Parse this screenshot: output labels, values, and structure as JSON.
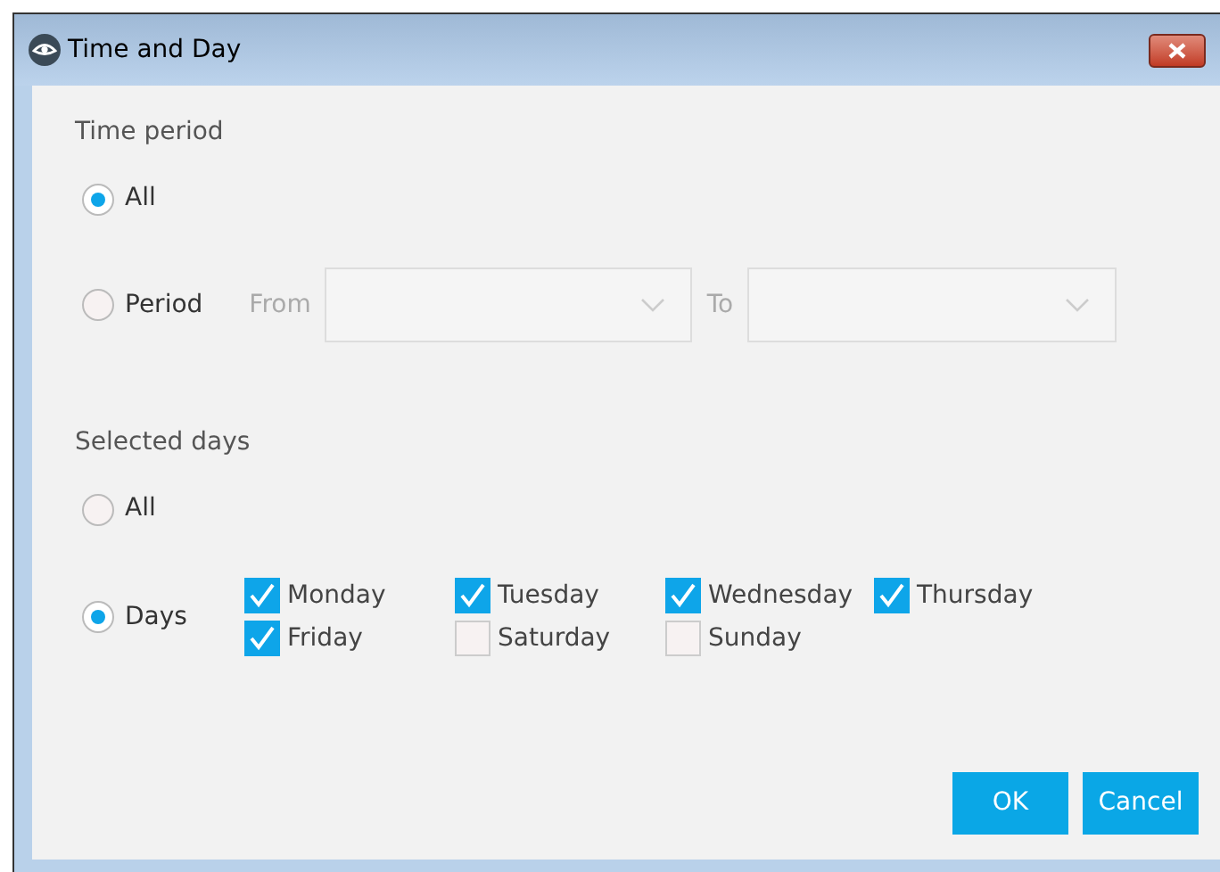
{
  "window": {
    "title": "Time and Day"
  },
  "time_period": {
    "label": "Time period",
    "options": [
      {
        "label": "All",
        "selected": true
      },
      {
        "label": "Period",
        "selected": false
      }
    ],
    "from": {
      "label": "From",
      "disabled": true
    },
    "to": {
      "label": "To",
      "disabled": true
    }
  },
  "selected_days": {
    "label": "Selected days",
    "options": [
      {
        "label": "All",
        "selected": false
      },
      {
        "label": "Days",
        "selected": true
      }
    ],
    "days": [
      {
        "label": "Monday",
        "checked": true
      },
      {
        "label": "Tuesday",
        "checked": true
      },
      {
        "label": "Wednesday",
        "checked": true
      },
      {
        "label": "Thursday",
        "checked": true
      },
      {
        "label": "Friday",
        "checked": true
      },
      {
        "label": "Saturday",
        "checked": false
      },
      {
        "label": "Sunday",
        "checked": false
      }
    ]
  },
  "buttons": [
    "OK",
    "Cancel"
  ]
}
